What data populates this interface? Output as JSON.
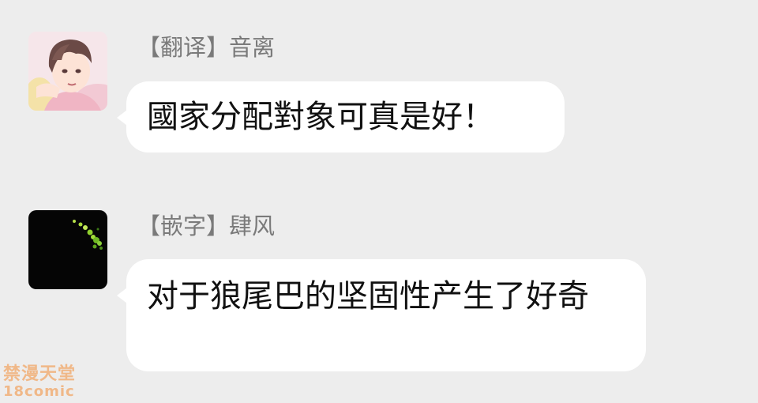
{
  "messages": [
    {
      "sender": "【翻译】音离",
      "text": "國家分配對象可真是好！",
      "avatar_icon": "anime-boy-avatar"
    },
    {
      "sender": "【嵌字】肆风",
      "text": "对于狼尾巴的坚固性产生了好奇",
      "avatar_icon": "dark-green-lights-avatar"
    }
  ],
  "watermark": {
    "line1": "禁漫天堂",
    "line2": "18comic"
  },
  "colors": {
    "background": "#ededed",
    "bubble": "#ffffff",
    "sender_text": "#7a7a7a",
    "message_text": "#111111"
  }
}
